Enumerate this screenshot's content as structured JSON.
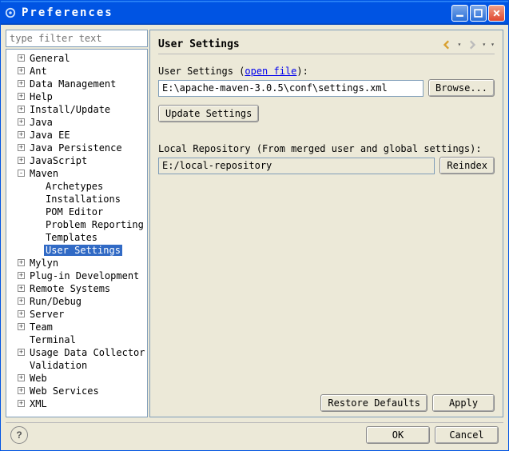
{
  "window": {
    "title": "Preferences"
  },
  "filter": {
    "placeholder": "type filter text"
  },
  "tree": {
    "items": [
      {
        "label": "General",
        "expand": "+"
      },
      {
        "label": "Ant",
        "expand": "+"
      },
      {
        "label": "Data Management",
        "expand": "+"
      },
      {
        "label": "Help",
        "expand": "+"
      },
      {
        "label": "Install/Update",
        "expand": "+"
      },
      {
        "label": "Java",
        "expand": "+"
      },
      {
        "label": "Java EE",
        "expand": "+"
      },
      {
        "label": "Java Persistence",
        "expand": "+"
      },
      {
        "label": "JavaScript",
        "expand": "+"
      },
      {
        "label": "Maven",
        "expand": "-",
        "children": [
          {
            "label": "Archetypes"
          },
          {
            "label": "Installations"
          },
          {
            "label": "POM Editor"
          },
          {
            "label": "Problem Reporting"
          },
          {
            "label": "Templates"
          },
          {
            "label": "User Settings",
            "selected": true
          }
        ]
      },
      {
        "label": "Mylyn",
        "expand": "+"
      },
      {
        "label": "Plug-in Development",
        "expand": "+"
      },
      {
        "label": "Remote Systems",
        "expand": "+"
      },
      {
        "label": "Run/Debug",
        "expand": "+"
      },
      {
        "label": "Server",
        "expand": "+"
      },
      {
        "label": "Team",
        "expand": "+"
      },
      {
        "label": "Terminal"
      },
      {
        "label": "Usage Data Collector",
        "expand": "+"
      },
      {
        "label": "Validation"
      },
      {
        "label": "Web",
        "expand": "+"
      },
      {
        "label": "Web Services",
        "expand": "+"
      },
      {
        "label": "XML",
        "expand": "+"
      }
    ]
  },
  "panel": {
    "title": "User Settings",
    "userSettings": {
      "labelPrefix": "User Settings (",
      "link": "open file",
      "labelSuffix": "):",
      "value": "E:\\apache-maven-3.0.5\\conf\\settings.xml",
      "browse": "Browse..."
    },
    "updateSettings": "Update Settings",
    "localRepo": {
      "label": "Local Repository (From merged user and global settings):",
      "value": "E:/local-repository",
      "reindex": "Reindex"
    },
    "restoreDefaults": "Restore Defaults",
    "apply": "Apply"
  },
  "dialog": {
    "ok": "OK",
    "cancel": "Cancel",
    "help": "?"
  }
}
